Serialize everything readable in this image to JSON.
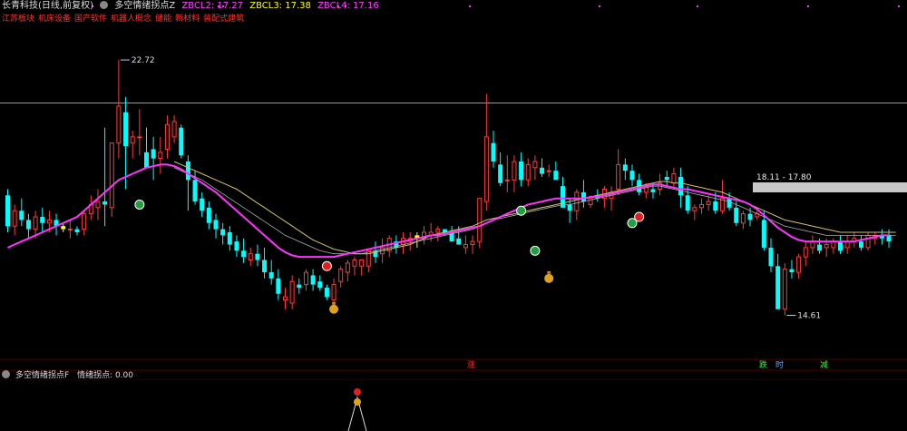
{
  "header": {
    "stock_title": "长青科技(日线,前复权)",
    "indicator_name": "多空情绪拐点Z",
    "zbcl2": "ZBCL2: 17.27",
    "zbcl3": "ZBCL3: 17.38",
    "zbcl4": "ZBCL4: 17.16",
    "colors": {
      "zbcl2": "#ff44ff",
      "zbcl3": "#ffff00",
      "zbcl4": "#ff44ff"
    }
  },
  "concept_tags": [
    "江苏板块",
    "机床设备",
    "国产软件",
    "机器人概念",
    "储能",
    "新材料",
    "装配式建筑"
  ],
  "annotations": {
    "high_label": "22.72",
    "low_label": "14.61",
    "price_range_label": "18.11 - 17.80"
  },
  "bottom_markers": [
    {
      "text": "涨",
      "color": "#ff3030"
    },
    {
      "text": "跌",
      "color": "#33ff33"
    },
    {
      "text": "时",
      "color": "#66aaff"
    },
    {
      "text": "减",
      "color": "#33ff33"
    }
  ],
  "sub_panel": {
    "indicator_name": "多空情绪拐点F",
    "value_label": "情绪拐点: 0.00"
  },
  "colors": {
    "up": "#ff3b3b",
    "down": "#00ffff",
    "highlight": "#ffff00",
    "ma_main": "#ff33ff",
    "ma_slow": "#d4c16a",
    "ma_mid": "#aaaaaa",
    "hline": "#b8a800"
  },
  "chart_data": {
    "type": "candlestick",
    "ylim": [
      13.0,
      24.0
    ],
    "hline": 21.3,
    "ohlc": [
      [
        18.3,
        18.5,
        17.1,
        17.3
      ],
      [
        17.3,
        18.0,
        17.0,
        17.8
      ],
      [
        17.8,
        18.2,
        17.3,
        17.5
      ],
      [
        17.5,
        17.7,
        16.9,
        17.2
      ],
      [
        17.2,
        17.8,
        16.9,
        17.6
      ],
      [
        17.6,
        17.9,
        17.1,
        17.4
      ],
      [
        17.4,
        17.8,
        17.1,
        17.5
      ],
      [
        17.5,
        17.7,
        17.0,
        17.3
      ],
      [
        17.3,
        17.4,
        17.1,
        17.2
      ],
      [
        17.2,
        17.5,
        16.9,
        17.2
      ],
      [
        17.2,
        17.3,
        17.0,
        17.1
      ],
      [
        17.2,
        17.8,
        17.0,
        17.7
      ],
      [
        17.7,
        18.3,
        17.5,
        18.0
      ],
      [
        17.9,
        18.5,
        17.5,
        18.1
      ],
      [
        18.1,
        20.5,
        17.3,
        18.0
      ],
      [
        17.9,
        18.6,
        17.6,
        20.0
      ],
      [
        20.0,
        22.7,
        19.5,
        21.2
      ],
      [
        21.0,
        21.5,
        18.5,
        19.9
      ],
      [
        20.0,
        20.4,
        19.5,
        20.2
      ],
      [
        20.2,
        21.1,
        19.6,
        20.2
      ],
      [
        19.7,
        20.5,
        19.3,
        19.2
      ],
      [
        19.8,
        20.2,
        18.8,
        19.5
      ],
      [
        19.5,
        20.2,
        19.0,
        19.7
      ],
      [
        19.8,
        20.9,
        19.5,
        20.6
      ],
      [
        20.2,
        20.9,
        20.0,
        20.7
      ],
      [
        20.5,
        20.6,
        19.5,
        19.6
      ],
      [
        19.4,
        19.6,
        17.8,
        18.8
      ],
      [
        18.8,
        19.1,
        18.0,
        18.1
      ],
      [
        18.2,
        18.4,
        17.6,
        17.8
      ],
      [
        17.9,
        18.1,
        17.2,
        17.4
      ],
      [
        17.5,
        17.7,
        16.9,
        17.2
      ],
      [
        17.2,
        17.4,
        16.7,
        17.0
      ],
      [
        17.1,
        17.3,
        16.5,
        16.7
      ],
      [
        16.8,
        17.0,
        16.3,
        16.5
      ],
      [
        16.5,
        16.9,
        16.1,
        16.3
      ],
      [
        16.2,
        16.6,
        16.0,
        16.4
      ],
      [
        16.4,
        16.7,
        16.0,
        16.2
      ],
      [
        16.2,
        16.6,
        15.6,
        15.8
      ],
      [
        15.8,
        16.2,
        15.4,
        15.6
      ],
      [
        15.6,
        15.9,
        14.9,
        15.1
      ],
      [
        14.9,
        15.3,
        14.6,
        15.0
      ],
      [
        14.8,
        15.7,
        14.6,
        15.5
      ],
      [
        15.4,
        15.6,
        15.1,
        15.3
      ],
      [
        15.4,
        15.9,
        15.2,
        15.8
      ],
      [
        15.7,
        15.9,
        15.2,
        15.4
      ],
      [
        15.5,
        15.7,
        15.2,
        15.3
      ],
      [
        15.3,
        15.4,
        14.9,
        15.0
      ],
      [
        14.9,
        15.6,
        14.7,
        15.4
      ],
      [
        15.5,
        16.0,
        15.3,
        15.9
      ],
      [
        15.8,
        16.2,
        15.5,
        16.1
      ],
      [
        16.0,
        16.3,
        15.7,
        16.2
      ],
      [
        16.0,
        16.2,
        15.7,
        16.2
      ],
      [
        16.0,
        16.5,
        15.8,
        16.5
      ],
      [
        16.5,
        16.8,
        16.1,
        16.3
      ],
      [
        16.4,
        16.9,
        16.1,
        16.6
      ],
      [
        16.5,
        17.0,
        16.3,
        16.9
      ],
      [
        16.8,
        17.0,
        16.4,
        16.6
      ],
      [
        16.7,
        17.1,
        16.4,
        16.9
      ],
      [
        16.8,
        17.1,
        16.5,
        16.9
      ],
      [
        16.9,
        17.1,
        16.6,
        17.0
      ],
      [
        16.9,
        17.3,
        16.7,
        17.1
      ],
      [
        17.0,
        17.4,
        16.8,
        17.1
      ],
      [
        17.1,
        17.3,
        16.8,
        17.2
      ],
      [
        17.2,
        17.2,
        17.0,
        17.1
      ],
      [
        17.1,
        17.3,
        16.8,
        16.8
      ],
      [
        16.9,
        17.3,
        16.8,
        16.7
      ],
      [
        16.6,
        17.0,
        16.4,
        16.7
      ],
      [
        16.7,
        17.0,
        16.4,
        16.8
      ],
      [
        16.8,
        18.2,
        16.6,
        18.2
      ],
      [
        18.1,
        21.6,
        17.8,
        20.2
      ],
      [
        20.0,
        20.4,
        19.2,
        19.4
      ],
      [
        19.3,
        19.7,
        18.6,
        18.7
      ],
      [
        18.8,
        19.6,
        18.4,
        18.8
      ],
      [
        18.8,
        19.6,
        18.4,
        19.4
      ],
      [
        19.4,
        19.7,
        18.6,
        18.8
      ],
      [
        18.8,
        19.5,
        18.6,
        19.3
      ],
      [
        19.2,
        19.6,
        18.8,
        19.4
      ],
      [
        19.2,
        19.5,
        18.9,
        19.0
      ],
      [
        19.1,
        19.3,
        18.9,
        19.1
      ],
      [
        19.1,
        19.4,
        18.8,
        18.8
      ],
      [
        18.6,
        18.9,
        17.9,
        17.9
      ],
      [
        18.0,
        18.2,
        17.4,
        17.8
      ],
      [
        17.8,
        18.5,
        17.5,
        18.4
      ],
      [
        18.4,
        18.8,
        17.9,
        18.1
      ],
      [
        18.0,
        18.3,
        17.9,
        18.2
      ],
      [
        18.3,
        18.5,
        18.1,
        18.2
      ],
      [
        18.2,
        18.6,
        17.9,
        18.5
      ],
      [
        18.2,
        18.6,
        17.8,
        18.4
      ],
      [
        18.5,
        19.8,
        18.3,
        19.3
      ],
      [
        19.3,
        19.5,
        18.8,
        19.1
      ],
      [
        19.1,
        19.3,
        18.6,
        18.8
      ],
      [
        18.8,
        19.0,
        18.3,
        18.4
      ],
      [
        18.4,
        18.7,
        18.2,
        18.6
      ],
      [
        18.5,
        18.7,
        18.2,
        18.4
      ],
      [
        18.5,
        19.0,
        18.3,
        18.7
      ],
      [
        18.9,
        19.1,
        18.6,
        18.8
      ],
      [
        18.7,
        19.2,
        18.5,
        19.0
      ],
      [
        18.9,
        19.2,
        17.9,
        18.3
      ],
      [
        18.3,
        18.6,
        17.7,
        17.8
      ],
      [
        17.8,
        18.0,
        17.5,
        17.9
      ],
      [
        17.9,
        18.2,
        17.7,
        18.0
      ],
      [
        18.0,
        18.3,
        17.8,
        18.1
      ],
      [
        18.1,
        18.4,
        17.7,
        17.8
      ],
      [
        17.8,
        18.8,
        17.7,
        18.2
      ],
      [
        18.2,
        18.4,
        17.8,
        17.9
      ],
      [
        17.9,
        18.1,
        17.3,
        17.4
      ],
      [
        17.4,
        17.8,
        17.2,
        17.7
      ],
      [
        17.7,
        17.9,
        17.3,
        17.5
      ],
      [
        17.6,
        17.8,
        17.5,
        17.7
      ],
      [
        17.5,
        17.8,
        16.5,
        16.6
      ],
      [
        16.6,
        16.9,
        15.8,
        16.0
      ],
      [
        16.0,
        16.4,
        14.6,
        14.6
      ],
      [
        14.6,
        16.1,
        14.4,
        15.9
      ],
      [
        15.9,
        16.2,
        15.6,
        15.8
      ],
      [
        15.8,
        16.4,
        15.6,
        16.3
      ],
      [
        16.3,
        16.8,
        16.0,
        16.6
      ],
      [
        16.6,
        17.0,
        16.4,
        16.8
      ],
      [
        16.7,
        16.9,
        16.4,
        16.5
      ],
      [
        16.6,
        16.9,
        16.3,
        16.7
      ],
      [
        16.6,
        16.9,
        16.4,
        16.8
      ],
      [
        16.8,
        17.0,
        16.4,
        16.5
      ],
      [
        16.6,
        17.0,
        16.4,
        16.8
      ],
      [
        16.8,
        17.1,
        16.6,
        16.9
      ],
      [
        16.8,
        17.0,
        16.5,
        16.6
      ],
      [
        16.6,
        17.1,
        16.5,
        17.0
      ],
      [
        16.9,
        17.1,
        16.7,
        17.0
      ],
      [
        17.0,
        17.2,
        16.7,
        16.9
      ],
      [
        17.0,
        17.2,
        16.6,
        16.8
      ]
    ],
    "highlight_candles": [
      8,
      59
    ],
    "ma_main": [
      16.6,
      16.7,
      16.8,
      16.9,
      17.0,
      17.1,
      17.2,
      17.3,
      17.4,
      17.5,
      17.6,
      17.8,
      18.0,
      18.2,
      18.4,
      18.6,
      18.8,
      18.9,
      19.0,
      19.1,
      19.2,
      19.25,
      19.3,
      19.3,
      19.25,
      19.15,
      19.0,
      18.85,
      18.7,
      18.55,
      18.4,
      18.2,
      18.0,
      17.8,
      17.6,
      17.4,
      17.2,
      17.0,
      16.8,
      16.6,
      16.45,
      16.35,
      16.3,
      16.3,
      16.3,
      16.3,
      16.3,
      16.3,
      16.35,
      16.4,
      16.45,
      16.5,
      16.55,
      16.6,
      16.65,
      16.7,
      16.75,
      16.8,
      16.85,
      16.9,
      16.95,
      17.0,
      17.0,
      17.05,
      17.1,
      17.15,
      17.2,
      17.25,
      17.3,
      17.4,
      17.5,
      17.6,
      17.7,
      17.8,
      17.9,
      18.0,
      18.05,
      18.1,
      18.15,
      18.2,
      18.2,
      18.2,
      18.2,
      18.2,
      18.25,
      18.25,
      18.3,
      18.35,
      18.4,
      18.45,
      18.5,
      18.55,
      18.6,
      18.65,
      18.65,
      18.6,
      18.55,
      18.5,
      18.5,
      18.45,
      18.4,
      18.35,
      18.3,
      18.25,
      18.2,
      18.15,
      18.1,
      18.0,
      17.85,
      17.65,
      17.45,
      17.25,
      17.1,
      16.95,
      16.85,
      16.8,
      16.8,
      16.8,
      16.8,
      16.8,
      16.8,
      16.8,
      16.8,
      16.85,
      16.9,
      16.95,
      17.0,
      17.0
    ],
    "ma_slow": [
      null,
      null,
      null,
      null,
      null,
      null,
      null,
      null,
      null,
      null,
      null,
      null,
      null,
      null,
      null,
      null,
      null,
      null,
      null,
      null,
      null,
      null,
      null,
      null,
      19.4,
      19.3,
      19.2,
      19.1,
      19.0,
      18.9,
      18.8,
      18.7,
      18.6,
      18.5,
      18.35,
      18.2,
      18.05,
      17.9,
      17.75,
      17.6,
      17.45,
      17.3,
      17.15,
      17.0,
      16.85,
      16.75,
      16.65,
      16.55,
      16.5,
      16.45,
      16.4,
      16.4,
      16.4,
      16.45,
      16.5,
      16.55,
      16.6,
      16.65,
      16.7,
      16.8,
      16.9,
      17.0,
      17.05,
      17.1,
      17.15,
      17.2,
      17.25,
      17.3,
      17.4,
      17.5,
      17.55,
      17.6,
      17.65,
      17.7,
      17.75,
      17.8,
      17.85,
      17.9,
      17.95,
      18.0,
      18.05,
      18.1,
      18.15,
      18.2,
      18.25,
      18.3,
      18.35,
      18.4,
      18.45,
      18.5,
      18.55,
      18.6,
      18.65,
      18.7,
      18.75,
      18.75,
      18.7,
      18.7,
      18.65,
      18.6,
      18.55,
      18.5,
      18.45,
      18.4,
      18.3,
      18.2,
      18.1,
      18.0,
      17.9,
      17.8,
      17.7,
      17.6,
      17.5,
      17.45,
      17.4,
      17.35,
      17.3,
      17.25,
      17.2,
      17.15,
      17.1,
      17.1,
      17.1,
      17.1,
      17.1,
      17.1,
      17.1,
      17.1,
      17.1
    ],
    "ma_mid": [
      null,
      null,
      null,
      null,
      null,
      null,
      null,
      null,
      null,
      null,
      null,
      null,
      null,
      null,
      null,
      null,
      null,
      null,
      null,
      null,
      null,
      null,
      null,
      null,
      19.2,
      19.1,
      19.0,
      18.9,
      18.8,
      18.65,
      18.5,
      18.35,
      18.2,
      18.05,
      17.9,
      17.75,
      17.6,
      17.45,
      17.3,
      17.15,
      17.0,
      16.9,
      16.8,
      16.7,
      16.6,
      16.5,
      16.45,
      16.4,
      16.4,
      16.4,
      16.4,
      16.4,
      16.45,
      16.5,
      16.55,
      16.6,
      16.65,
      16.7,
      16.75,
      16.8,
      16.85,
      16.9,
      16.95,
      17.0,
      17.05,
      17.1,
      17.15,
      17.2,
      17.3,
      17.4,
      17.5,
      17.55,
      17.6,
      17.65,
      17.7,
      17.75,
      17.8,
      17.85,
      17.9,
      17.95,
      18.0,
      18.0,
      18.05,
      18.1,
      18.15,
      18.2,
      18.25,
      18.3,
      18.35,
      18.4,
      18.45,
      18.5,
      18.55,
      18.6,
      18.6,
      18.55,
      18.5,
      18.45,
      18.4,
      18.35,
      18.3,
      18.25,
      18.2,
      18.15,
      18.1,
      18.0,
      17.9,
      17.8,
      17.7,
      17.6,
      17.5,
      17.4,
      17.3,
      17.25,
      17.2,
      17.15,
      17.1,
      17.05,
      17.0,
      17.0,
      17.0,
      17.0,
      17.0,
      17.0,
      17.0,
      17.0,
      17.0,
      17.0,
      17.0
    ],
    "icons": [
      {
        "i": 19,
        "y": 18.0,
        "kind": "green-badge"
      },
      {
        "i": 46,
        "y": 16.0,
        "kind": "red-badge"
      },
      {
        "i": 47,
        "y": 14.6,
        "kind": "money-bag"
      },
      {
        "i": 74,
        "y": 17.8,
        "kind": "green-badge"
      },
      {
        "i": 76,
        "y": 16.5,
        "kind": "green-badge"
      },
      {
        "i": 78,
        "y": 15.6,
        "kind": "money-bag"
      },
      {
        "i": 90,
        "y": 17.4,
        "kind": "green-badge"
      },
      {
        "i": 91,
        "y": 17.6,
        "kind": "red-badge"
      }
    ],
    "sub_ylim": [
      0,
      1
    ]
  }
}
